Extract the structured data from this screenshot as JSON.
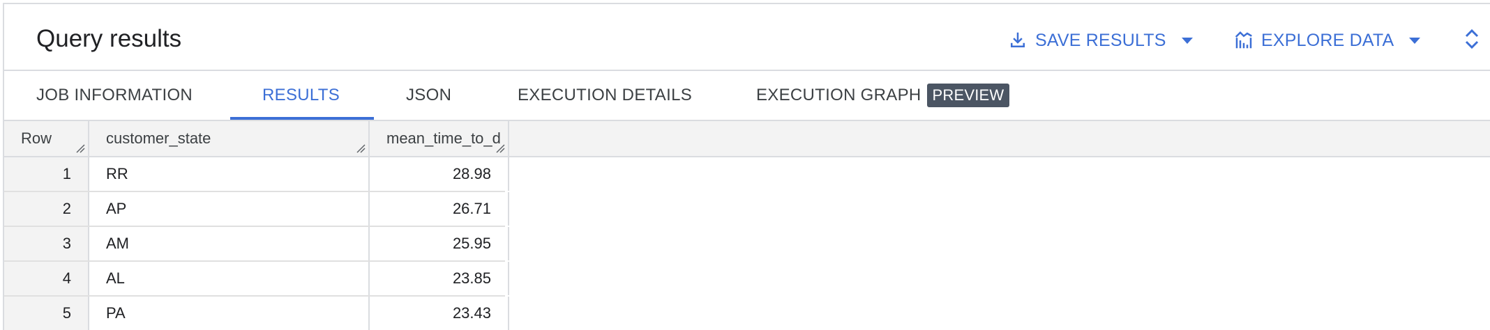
{
  "header": {
    "title": "Query results",
    "save_label": "SAVE RESULTS",
    "explore_label": "EXPLORE DATA"
  },
  "tabs": [
    {
      "label": "JOB INFORMATION",
      "active": false
    },
    {
      "label": "RESULTS",
      "active": true
    },
    {
      "label": "JSON",
      "active": false
    },
    {
      "label": "EXECUTION DETAILS",
      "active": false
    },
    {
      "label": "EXECUTION GRAPH",
      "active": false,
      "badge": "PREVIEW"
    }
  ],
  "table": {
    "columns": [
      "Row",
      "customer_state",
      "mean_time_to_d"
    ],
    "rows": [
      {
        "row": "1",
        "customer_state": "RR",
        "mean": "28.98"
      },
      {
        "row": "2",
        "customer_state": "AP",
        "mean": "26.71"
      },
      {
        "row": "3",
        "customer_state": "AM",
        "mean": "25.95"
      },
      {
        "row": "4",
        "customer_state": "AL",
        "mean": "23.85"
      },
      {
        "row": "5",
        "customer_state": "PA",
        "mean": "23.43"
      }
    ]
  },
  "colors": {
    "accent": "#3c6fd6",
    "badge": "#4b5563",
    "header_bg": "#f3f3f3",
    "border": "#dadce0"
  },
  "icons": {
    "save": "download-icon",
    "explore": "chart-icon",
    "expand": "expand-collapse-icon",
    "resize": "resize-handle-icon"
  }
}
